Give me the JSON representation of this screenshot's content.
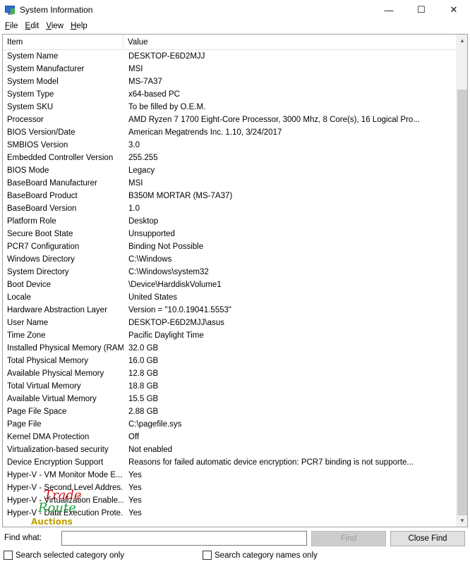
{
  "window": {
    "title": "System Information",
    "minimize_glyph": "—",
    "maximize_glyph": "☐",
    "close_glyph": "✕"
  },
  "menu": [
    {
      "accel": "F",
      "rest": "ile"
    },
    {
      "accel": "E",
      "rest": "dit"
    },
    {
      "accel": "V",
      "rest": "iew"
    },
    {
      "accel": "H",
      "rest": "elp"
    }
  ],
  "table": {
    "columns": [
      "Item",
      "Value"
    ],
    "rows": [
      [
        "System Name",
        "DESKTOP-E6D2MJJ"
      ],
      [
        "System Manufacturer",
        "MSI"
      ],
      [
        "System Model",
        "MS-7A37"
      ],
      [
        "System Type",
        "x64-based PC"
      ],
      [
        "System SKU",
        "To be filled by O.E.M."
      ],
      [
        "Processor",
        "AMD Ryzen 7 1700 Eight-Core Processor, 3000 Mhz, 8 Core(s), 16 Logical Pro..."
      ],
      [
        "BIOS Version/Date",
        "American Megatrends Inc. 1.10, 3/24/2017"
      ],
      [
        "SMBIOS Version",
        "3.0"
      ],
      [
        "Embedded Controller Version",
        "255.255"
      ],
      [
        "BIOS Mode",
        "Legacy"
      ],
      [
        "BaseBoard Manufacturer",
        "MSI"
      ],
      [
        "BaseBoard Product",
        "B350M MORTAR (MS-7A37)"
      ],
      [
        "BaseBoard Version",
        "1.0"
      ],
      [
        "Platform Role",
        "Desktop"
      ],
      [
        "Secure Boot State",
        "Unsupported"
      ],
      [
        "PCR7 Configuration",
        "Binding Not Possible"
      ],
      [
        "Windows Directory",
        "C:\\Windows"
      ],
      [
        "System Directory",
        "C:\\Windows\\system32"
      ],
      [
        "Boot Device",
        "\\Device\\HarddiskVolume1"
      ],
      [
        "Locale",
        "United States"
      ],
      [
        "Hardware Abstraction Layer",
        "Version = \"10.0.19041.5553\""
      ],
      [
        "User Name",
        "DESKTOP-E6D2MJJ\\asus"
      ],
      [
        "Time Zone",
        "Pacific Daylight Time"
      ],
      [
        "Installed Physical Memory (RAM)",
        "32.0 GB"
      ],
      [
        "Total Physical Memory",
        "16.0 GB"
      ],
      [
        "Available Physical Memory",
        "12.8 GB"
      ],
      [
        "Total Virtual Memory",
        "18.8 GB"
      ],
      [
        "Available Virtual Memory",
        "15.5 GB"
      ],
      [
        "Page File Space",
        "2.88 GB"
      ],
      [
        "Page File",
        "C:\\pagefile.sys"
      ],
      [
        "Kernel DMA Protection",
        "Off"
      ],
      [
        "Virtualization-based security",
        "Not enabled"
      ],
      [
        "Device Encryption Support",
        "Reasons for failed automatic device encryption: PCR7 binding is not supporte..."
      ],
      [
        "Hyper-V - VM Monitor Mode E...",
        "Yes"
      ],
      [
        "Hyper-V - Second Level Addres...",
        "Yes"
      ],
      [
        "Hyper-V - Virtualization Enable...",
        "Yes"
      ],
      [
        "Hyper-V - Data Execution Prote...",
        "Yes"
      ]
    ]
  },
  "find": {
    "label": "Find what:",
    "value": "",
    "find_button": "Find",
    "close_button": "Close Find"
  },
  "options": {
    "search_selected": "Search selected category only",
    "search_names": "Search category names only"
  },
  "watermark": {
    "line1": "Trade",
    "line2": "Route",
    "line3": "Auctions"
  }
}
